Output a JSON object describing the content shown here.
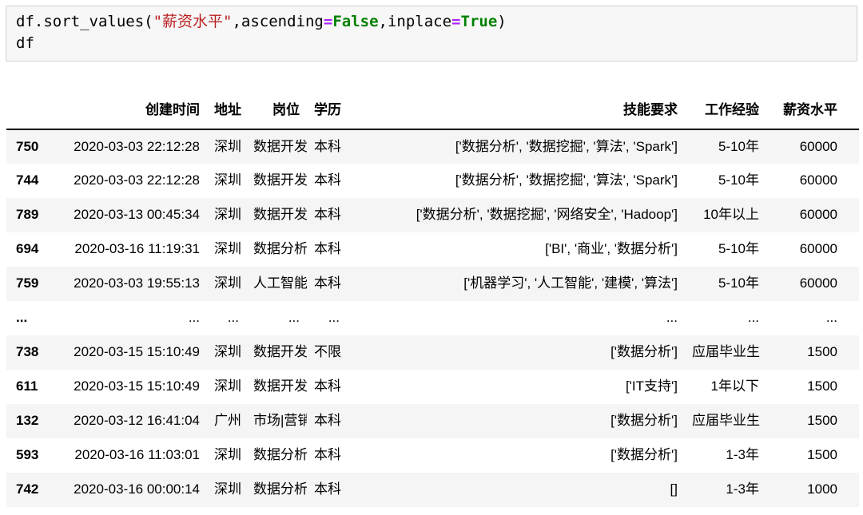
{
  "code_cell": {
    "lines": [
      {
        "tokens": [
          {
            "t": "df.sort_values(",
            "type": "plain"
          },
          {
            "t": "\"薪资水平\"",
            "type": "string"
          },
          {
            "t": ",ascending",
            "type": "plain"
          },
          {
            "t": "=",
            "type": "operator"
          },
          {
            "t": "False",
            "type": "keyword"
          },
          {
            "t": ",inplace",
            "type": "plain"
          },
          {
            "t": "=",
            "type": "operator"
          },
          {
            "t": "True",
            "type": "keyword"
          },
          {
            "t": ")",
            "type": "plain"
          }
        ]
      },
      {
        "tokens": [
          {
            "t": "df",
            "type": "plain"
          }
        ]
      }
    ],
    "colors": {
      "string": "#ba2121",
      "operator": "#AA22FF",
      "keyword": "#008000",
      "background": "#f7f7f7",
      "border": "#cfcfcf"
    }
  },
  "table": {
    "index_header": "",
    "columns": [
      "创建时间",
      "地址",
      "岗位",
      "学历",
      "技能要求",
      "工作经验",
      "薪资水平"
    ],
    "rows": [
      {
        "index": "750",
        "cells": [
          "2020-03-03 22:12:28",
          "深圳",
          "数据开发",
          "本科",
          "['数据分析', '数据挖掘', '算法', 'Spark']",
          "5-10年",
          "60000"
        ]
      },
      {
        "index": "744",
        "cells": [
          "2020-03-03 22:12:28",
          "深圳",
          "数据开发",
          "本科",
          "['数据分析', '数据挖掘', '算法', 'Spark']",
          "5-10年",
          "60000"
        ]
      },
      {
        "index": "789",
        "cells": [
          "2020-03-13 00:45:34",
          "深圳",
          "数据开发",
          "本科",
          "['数据分析', '数据挖掘', '网络安全', 'Hadoop']",
          "10年以上",
          "60000"
        ]
      },
      {
        "index": "694",
        "cells": [
          "2020-03-16 11:19:31",
          "深圳",
          "数据分析",
          "本科",
          "['BI', '商业', '数据分析']",
          "5-10年",
          "60000"
        ]
      },
      {
        "index": "759",
        "cells": [
          "2020-03-03 19:55:13",
          "深圳",
          "人工智能",
          "本科",
          "['机器学习', '人工智能', '建模', '算法']",
          "5-10年",
          "60000"
        ]
      },
      {
        "index": "...",
        "cells": [
          "...",
          "...",
          "...",
          "...",
          "...",
          "...",
          "..."
        ]
      },
      {
        "index": "738",
        "cells": [
          "2020-03-15 15:10:49",
          "深圳",
          "数据开发",
          "不限",
          "['数据分析']",
          "应届毕业生",
          "1500"
        ]
      },
      {
        "index": "611",
        "cells": [
          "2020-03-15 15:10:49",
          "深圳",
          "数据开发",
          "本科",
          "['IT支持']",
          "1年以下",
          "1500"
        ]
      },
      {
        "index": "132",
        "cells": [
          "2020-03-12 16:41:04",
          "广州",
          "市场|营销",
          "本科",
          "['数据分析']",
          "应届毕业生",
          "1500"
        ]
      },
      {
        "index": "593",
        "cells": [
          "2020-03-16 11:03:01",
          "深圳",
          "数据分析",
          "本科",
          "['数据分析']",
          "1-3年",
          "1500"
        ]
      },
      {
        "index": "742",
        "cells": [
          "2020-03-16 00:00:14",
          "深圳",
          "数据分析",
          "本科",
          "[]",
          "1-3年",
          "1000"
        ]
      }
    ],
    "stripe_color": "#f5f5f5",
    "header_border_color": "#000000"
  }
}
